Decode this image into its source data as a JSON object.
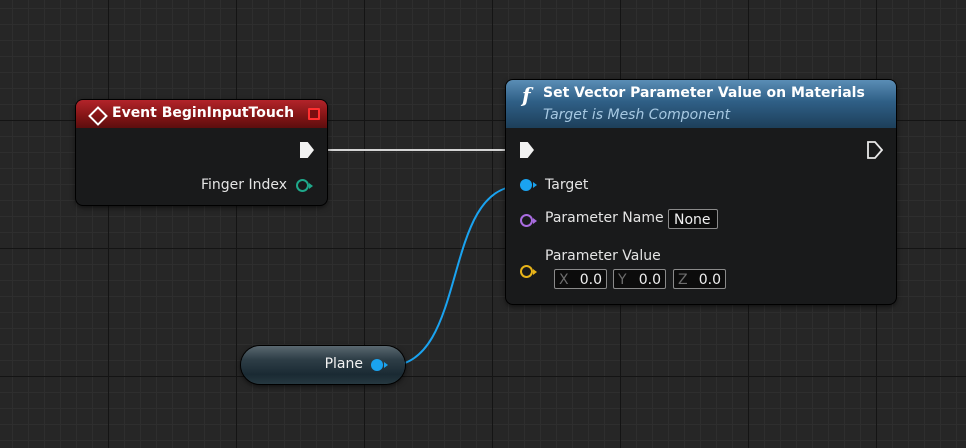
{
  "event_node": {
    "title": "Event BeginInputTouch",
    "pins": {
      "finger_index": "Finger Index"
    }
  },
  "function_node": {
    "icon": "f",
    "title": "Set Vector Parameter Value on Materials",
    "subtitle": "Target is Mesh Component",
    "pins": {
      "target": "Target",
      "parameter_name": "Parameter Name",
      "parameter_name_value": "None",
      "parameter_value": "Parameter Value"
    },
    "vector": {
      "x_label": "X",
      "x_value": "0.0",
      "y_label": "Y",
      "y_value": "0.0",
      "z_label": "Z",
      "z_value": "0.0"
    }
  },
  "variable_node": {
    "label": "Plane"
  },
  "colors": {
    "event_header": "#851516",
    "function_header": "#2f5f86",
    "object_pin": "#1aa3f0",
    "integer_pin": "#1fa88a",
    "name_pin": "#a96ce0",
    "struct_pin": "#e8b419",
    "exec_wire": "#d9d9d9"
  },
  "icons": [
    "event-diamond-icon",
    "function-icon",
    "exec-pin-icon",
    "delegate-pin-icon"
  ]
}
